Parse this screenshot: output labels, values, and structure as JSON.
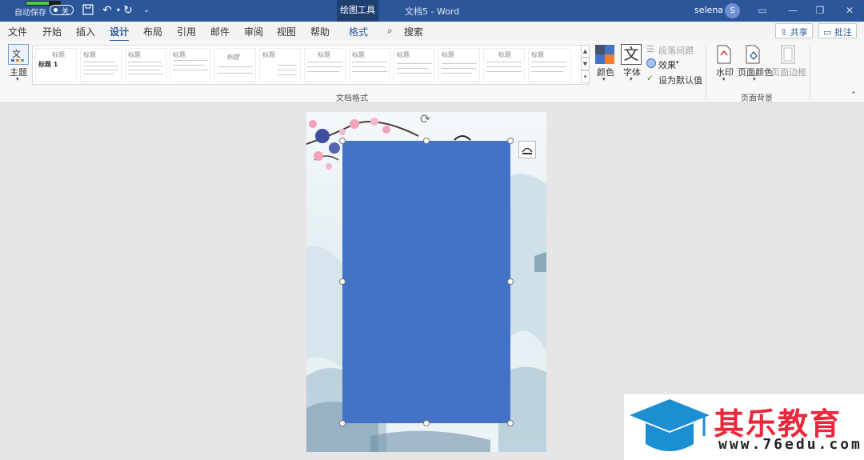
{
  "titlebar": {
    "autosave_label": "自动保存",
    "autosave_state": "关",
    "context_tab": "绘图工具",
    "doc_title": "文档5  -  Word",
    "user_name": "selena",
    "avatar_initial": "S"
  },
  "tabs": [
    "文件",
    "开始",
    "插入",
    "设计",
    "布局",
    "引用",
    "邮件",
    "审阅",
    "视图",
    "帮助",
    "格式"
  ],
  "active_tab": "设计",
  "search_label": "搜索",
  "share_label": "共享",
  "comment_label": "批注",
  "ribbon": {
    "theme_label": "主题",
    "style_heading": "标题",
    "style_heading_1": "标题 1",
    "colors_label": "颜色",
    "fonts_label": "字体",
    "fonts_glyph": "文",
    "paragraph_spacing": "段落间距",
    "effects": "效果",
    "set_default": "设为默认值",
    "group_doc_format": "文档格式",
    "watermark": "水印",
    "page_color": "页面颜色",
    "page_borders": "页面边框",
    "group_page_bg": "页面背景"
  },
  "colors": {
    "accent": "#2b579a",
    "shape_fill": "#4472c4",
    "watermark_red": "#e8283c"
  },
  "brand_watermark": {
    "name": "其乐教育",
    "url": "www.76edu.com"
  }
}
